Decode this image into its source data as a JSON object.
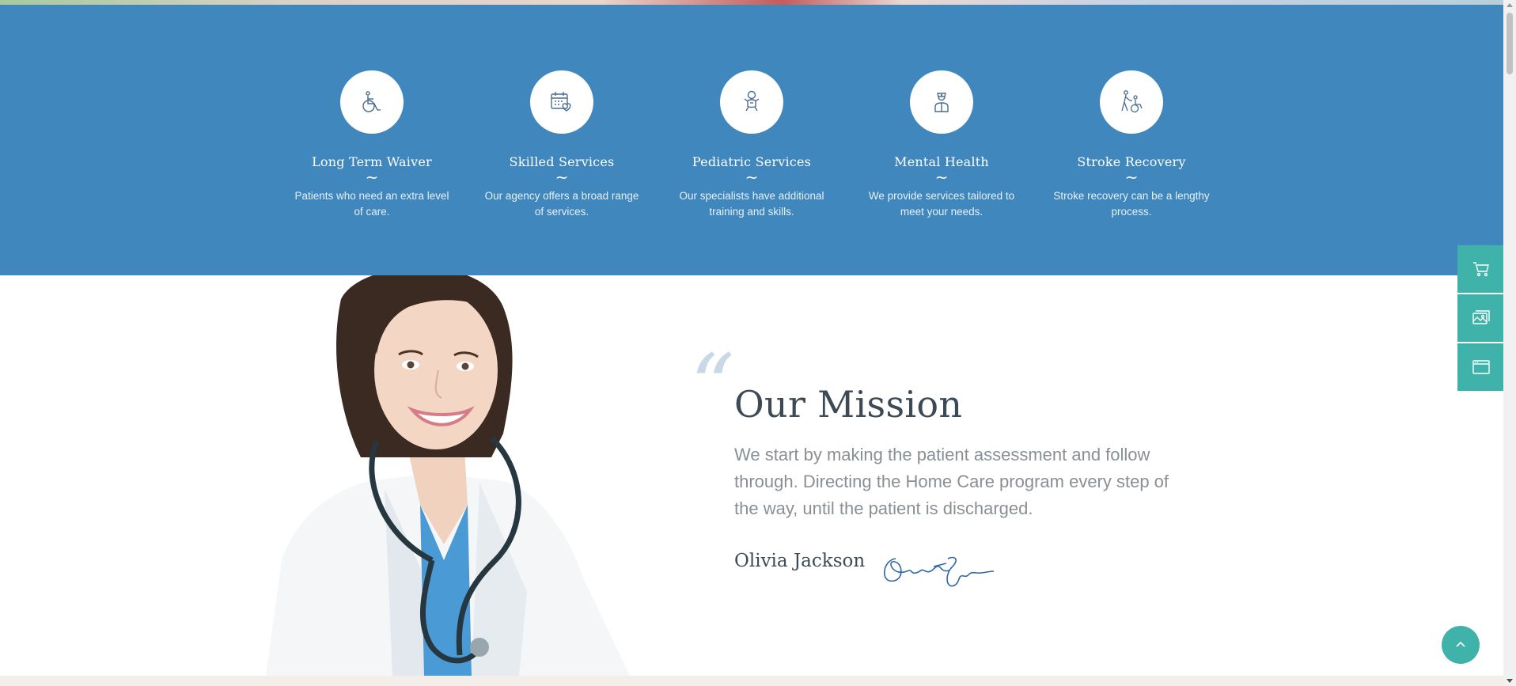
{
  "colors": {
    "band_blue": "#4087bd",
    "accent_teal": "#3fb2a9",
    "heading_dark": "#3d4a55",
    "body_gray": "#8a8f94"
  },
  "services": [
    {
      "icon": "wheelchair-icon",
      "title": "Long Term Waiver",
      "separator": "~",
      "description": "Patients who need an extra level of care."
    },
    {
      "icon": "calendar-heart-icon",
      "title": "Skilled Services",
      "separator": "~",
      "description": "Our agency offers a broad range of services."
    },
    {
      "icon": "baby-icon",
      "title": "Pediatric Services",
      "separator": "~",
      "description": "Our specialists have additional training and skills."
    },
    {
      "icon": "nurse-icon",
      "title": "Mental Health",
      "separator": "~",
      "description": "We provide services tailored to meet your needs."
    },
    {
      "icon": "caregiver-wheelchair-icon",
      "title": "Stroke Recovery",
      "separator": "~",
      "description": "Stroke recovery can be a lengthy process."
    }
  ],
  "mission": {
    "quote_mark": "“",
    "title": "Our Mission",
    "text": "We start by making the patient assessment and follow through. Directing the Home Care program every step of the way, until the patient is discharged.",
    "author": "Olivia Jackson",
    "signature_text": "Olivia Jackson"
  },
  "side_tools": [
    {
      "icon": "cart-icon"
    },
    {
      "icon": "gallery-icon"
    },
    {
      "icon": "browser-window-icon"
    }
  ],
  "back_to_top": {
    "icon": "chevron-up-icon"
  }
}
